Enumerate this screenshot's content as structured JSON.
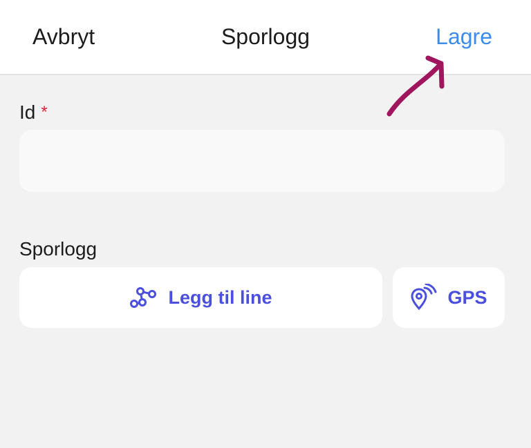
{
  "header": {
    "cancel_label": "Avbryt",
    "title": "Sporlogg",
    "save_label": "Lagre"
  },
  "form": {
    "id_field": {
      "label": "Id",
      "required_marker": "*",
      "value": ""
    },
    "tracklog": {
      "label": "Sporlogg",
      "add_line_label": "Legg til line",
      "gps_label": "GPS"
    }
  },
  "icons": {
    "add_line": "polyline-nodes-icon",
    "gps": "location-signal-icon"
  },
  "colors": {
    "accent": "#3c8cf0",
    "action": "#4a4fe0",
    "required": "#e0223a",
    "annotation": "#a0165e"
  }
}
